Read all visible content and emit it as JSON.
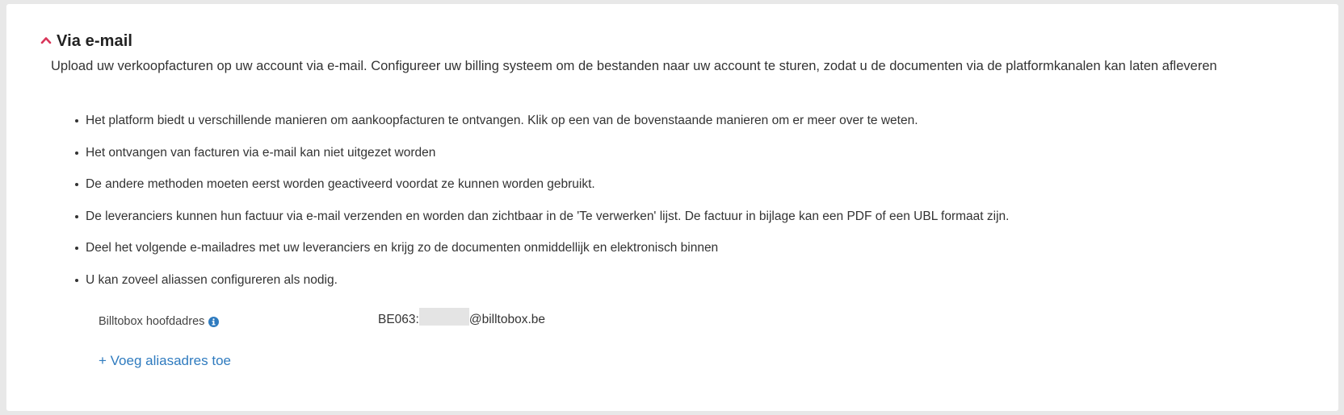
{
  "section": {
    "title": "Via e-mail",
    "description": "Upload uw verkoopfacturen op uw account via e-mail. Configureer uw billing systeem om de bestanden naar uw account te sturen, zodat u de documenten via de platformkanalen kan laten afleveren",
    "collapse_icon": "chevron-up-icon",
    "accent_color": "#d9365a"
  },
  "bullets": [
    "Het platform biedt u verschillende manieren om aankoopfacturen te ontvangen. Klik op een van de bovenstaande manieren om er meer over te weten.",
    "Het ontvangen van facturen via e-mail kan niet uitgezet worden",
    "De andere methoden moeten eerst worden geactiveerd voordat ze kunnen worden gebruikt.",
    "De leveranciers kunnen hun factuur via e-mail verzenden en worden dan zichtbaar in de 'Te verwerken' lijst. De factuur in bijlage kan een PDF of een UBL formaat zijn.",
    "Deel het volgende e-mailadres met uw leveranciers en krijg zo de documenten onmiddellijk en elektronisch binnen",
    "U kan zoveel aliassen configureren als nodig."
  ],
  "main_address": {
    "label": "Billtobox hoofdadres",
    "info_icon": "info-circle-icon",
    "prefix": "BE063:",
    "suffix": "@billtobox.be"
  },
  "add_alias": {
    "label": "+ Voeg aliasadres toe",
    "link_color": "#2f7bbf"
  }
}
